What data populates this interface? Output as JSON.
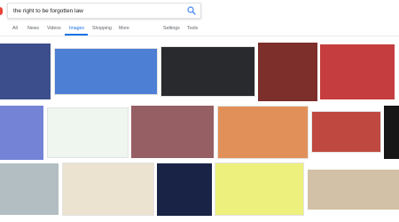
{
  "search": {
    "query": "the right to be forgotten law"
  },
  "tabs": [
    {
      "label": "All",
      "active": false
    },
    {
      "label": "News",
      "active": false
    },
    {
      "label": "Videos",
      "active": false
    },
    {
      "label": "Images",
      "active": true
    },
    {
      "label": "Shopping",
      "active": false
    },
    {
      "label": "More",
      "active": false
    }
  ],
  "tools": [
    {
      "label": "Settings"
    },
    {
      "label": "Tools"
    }
  ],
  "results": {
    "rows": [
      [
        {
          "color": "#3c4f8c",
          "border": false
        },
        {
          "color": "#4d7fd5",
          "border": true
        },
        {
          "color": "#282a2d",
          "border": true
        },
        {
          "color": "#7d2f2c",
          "border": false
        },
        {
          "color": "#c63d3f",
          "border": false
        }
      ],
      [
        {
          "color": "#7483d6",
          "border": false
        },
        {
          "color": "#eef6ef",
          "border": true
        },
        {
          "color": "#955f64",
          "border": false
        },
        {
          "color": "#e2905a",
          "border": true
        },
        {
          "color": "#bf4940",
          "border": true
        },
        {
          "color": "#171717",
          "border": false
        }
      ],
      [
        {
          "color": "#b2bec2",
          "border": false
        },
        {
          "color": "#ebe2d0",
          "border": true
        },
        {
          "color": "#192346",
          "border": false
        },
        {
          "color": "#eef07d",
          "border": true
        },
        {
          "color": "#d2c1a6",
          "border": false
        }
      ]
    ]
  }
}
